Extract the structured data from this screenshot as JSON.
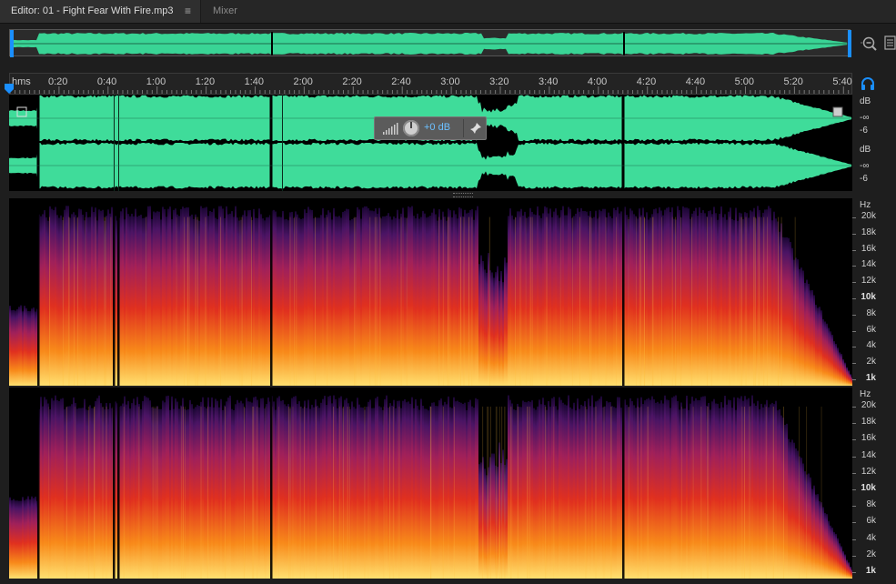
{
  "tabs": {
    "editor_label": "Editor: 01 - Fight Fear With Fire.mp3",
    "editor_menu_icon": "hamburger-menu-icon",
    "mixer_label": "Mixer"
  },
  "toolbar_icons": [
    "zoom-out-icon",
    "panel-icon",
    "headphone-icon"
  ],
  "ruler": {
    "unit_label": "hms",
    "labels": [
      "0:20",
      "0:40",
      "1:00",
      "1:20",
      "1:40",
      "2:00",
      "2:20",
      "2:40",
      "3:00",
      "3:20",
      "3:40",
      "4:00",
      "4:20",
      "4:40",
      "5:00",
      "5:20",
      "5:40"
    ]
  },
  "hud": {
    "gain_label": "+0 dB",
    "icons": [
      "level-meter-icon",
      "volume-knob-icon",
      "pin-icon"
    ]
  },
  "db_axis": {
    "channel_top": {
      "unit": "dB",
      "values": [
        "-∞",
        "-6"
      ]
    },
    "channel_bottom": {
      "unit": "dB",
      "values": [
        "-∞",
        "-6"
      ]
    }
  },
  "freq_axis": {
    "unit": "Hz",
    "labels": [
      "20k",
      "18k",
      "16k",
      "14k",
      "12k",
      "10k",
      "8k",
      "6k",
      "4k",
      "2k",
      "1k"
    ],
    "bold_labels": [
      "10k",
      "1k"
    ]
  },
  "colors": {
    "waveform": "#3fdc9a",
    "overview_waveform": "#39d495",
    "accent": "#1a8fff",
    "gain_text": "#6cc0ff"
  }
}
